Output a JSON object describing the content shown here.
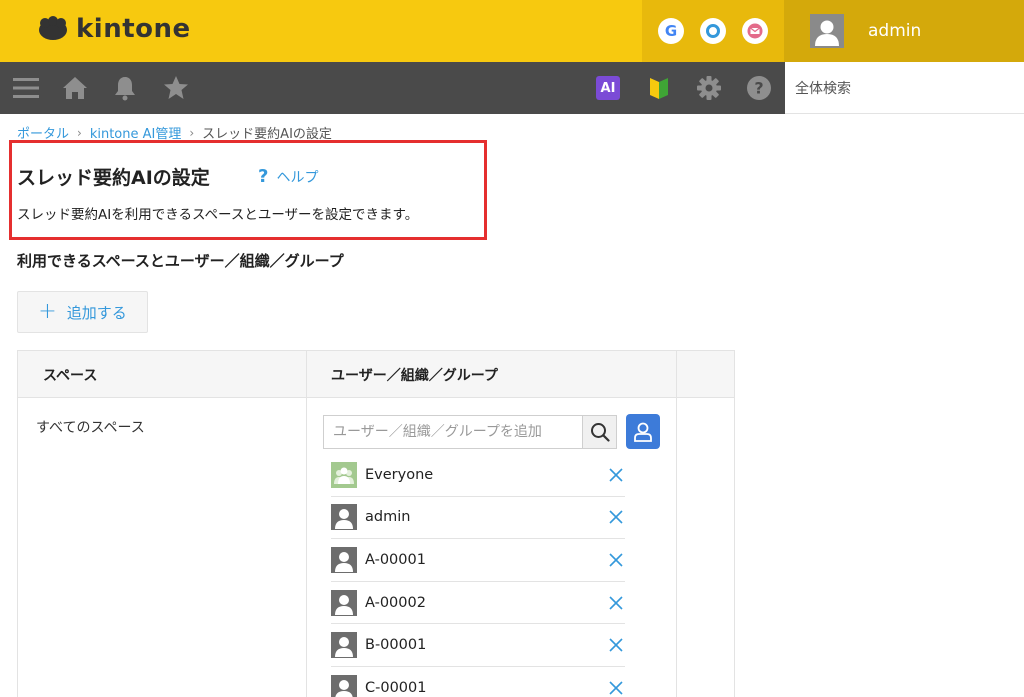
{
  "header": {
    "logo_text": "kintone",
    "user_name": "admin",
    "app_icons": [
      {
        "name": "google-icon",
        "letter": "G",
        "color": "#4285f4"
      },
      {
        "name": "garoon-icon",
        "color": "#3498db"
      },
      {
        "name": "mail-icon",
        "color": "#e36b8a"
      }
    ]
  },
  "navbar": {
    "search_placeholder": "全体検索",
    "ai_label": "AI"
  },
  "breadcrumb": {
    "items": [
      "ポータル",
      "kintone AI管理"
    ],
    "current": "スレッド要約AIの設定",
    "separator": "›"
  },
  "page": {
    "title": "スレッド要約AIの設定",
    "help_label": "ヘルプ",
    "help_symbol": "?",
    "description": "スレッド要約AIを利用できるスペースとユーザーを設定できます。",
    "section_title": "利用できるスペースとユーザー／組織／グループ",
    "add_button_label": "追加する",
    "add_symbol": "+"
  },
  "table": {
    "columns": [
      "スペース",
      "ユーザー／組織／グループ"
    ],
    "rows": [
      {
        "space": "すべてのスペース",
        "picker_placeholder": "ユーザー／組織／グループを追加",
        "entities": [
          {
            "type": "group",
            "name": "Everyone"
          },
          {
            "type": "user",
            "name": "admin"
          },
          {
            "type": "user",
            "name": "A-00001"
          },
          {
            "type": "user",
            "name": "A-00002"
          },
          {
            "type": "user",
            "name": "B-00001"
          },
          {
            "type": "user",
            "name": "C-00001"
          }
        ]
      }
    ]
  },
  "colors": {
    "header_yellow": "#f7c90f",
    "nav_dark": "#4a4a4a",
    "link_blue": "#3498db",
    "highlight_red": "#e52f2f",
    "ai_purple": "#7b4bd6"
  }
}
